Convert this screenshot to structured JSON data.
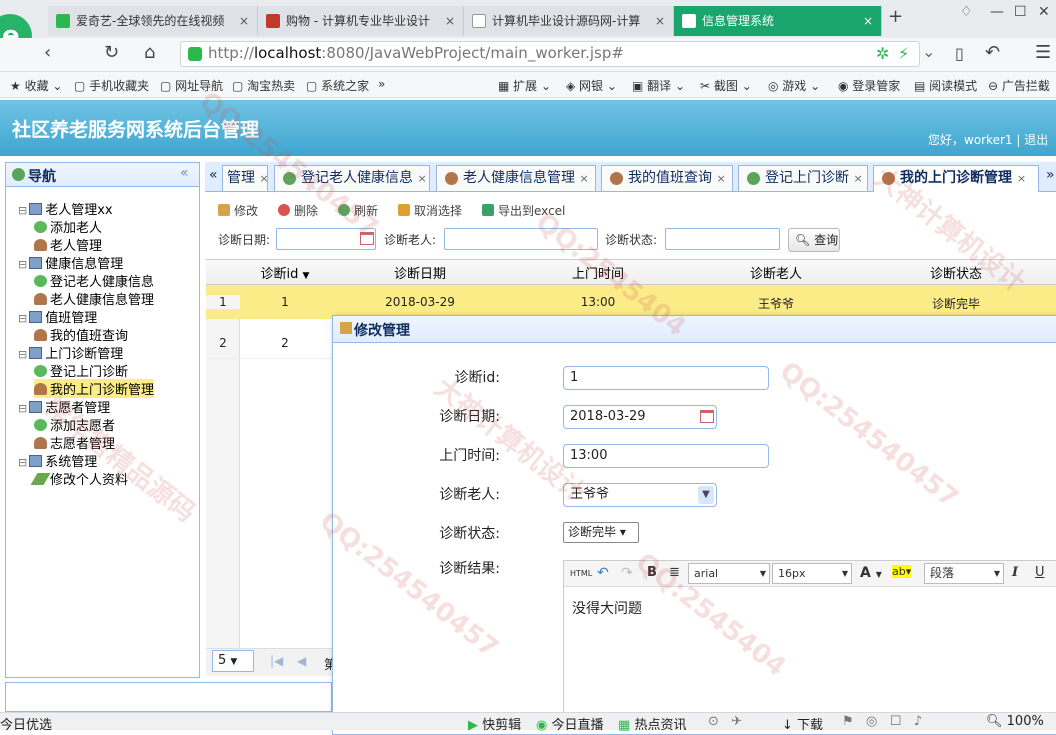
{
  "browser": {
    "tabs": [
      {
        "label": "爱奇艺-全球领先的在线视频"
      },
      {
        "label": "购物 - 计算机专业毕业设计"
      },
      {
        "label": "计算机毕业设计源码网-计算"
      },
      {
        "label": "信息管理系统"
      }
    ],
    "new_tab": "+",
    "url_prefix": "http://",
    "url_host": "localhost",
    "url_rest": ":8080/JavaWebProject/main_worker.jsp#",
    "bookmarks": [
      "收藏",
      "手机收藏夹",
      "网址导航",
      "淘宝热卖",
      "系统之家",
      "»",
      "扩展",
      "网银",
      "翻译",
      "截图",
      "游戏",
      "登录管家",
      "阅读模式",
      "广告拦截"
    ]
  },
  "app": {
    "title": "社区养老服务网系统后台管理",
    "greeting": "您好，worker1",
    "sep": "|",
    "logout": "退出"
  },
  "nav": {
    "title": "导航",
    "collapse": "«",
    "tree": [
      {
        "label": "老人管理xx",
        "type": "folder"
      },
      {
        "label": "添加老人",
        "type": "add"
      },
      {
        "label": "老人管理",
        "type": "user"
      },
      {
        "label": "健康信息管理",
        "type": "folder"
      },
      {
        "label": "登记老人健康信息",
        "type": "add"
      },
      {
        "label": "老人健康信息管理",
        "type": "user"
      },
      {
        "label": "值班管理",
        "type": "folder"
      },
      {
        "label": "我的值班查询",
        "type": "user"
      },
      {
        "label": "上门诊断管理",
        "type": "folder"
      },
      {
        "label": "登记上门诊断",
        "type": "add"
      },
      {
        "label": "我的上门诊断管理",
        "type": "user",
        "selected": true
      },
      {
        "label": "志愿者管理",
        "type": "folder"
      },
      {
        "label": "添加志愿者",
        "type": "add"
      },
      {
        "label": "志愿者管理",
        "type": "user"
      },
      {
        "label": "系统管理",
        "type": "folder"
      },
      {
        "label": "修改个人资料",
        "type": "pen"
      }
    ]
  },
  "tabs": {
    "scroll_left": "«",
    "scroll_right": "»",
    "items": [
      {
        "label": "管理"
      },
      {
        "label": "登记老人健康信息"
      },
      {
        "label": "老人健康信息管理"
      },
      {
        "label": "我的值班查询"
      },
      {
        "label": "登记上门诊断"
      },
      {
        "label": "我的上门诊断管理",
        "active": true
      }
    ],
    "close": "×"
  },
  "toolbar": {
    "edit": "修改",
    "delete": "删除",
    "refresh": "刷新",
    "cancel_select": "取消选择",
    "export": "导出到excel"
  },
  "filters": {
    "date_label": "诊断日期:",
    "elder_label": "诊断老人:",
    "state_label": "诊断状态:",
    "query": "查询"
  },
  "grid": {
    "columns": [
      "诊断id",
      "诊断日期",
      "上门时间",
      "诊断老人",
      "诊断状态"
    ],
    "rows": [
      {
        "num": "1",
        "id": "1",
        "date": "2018-03-29",
        "time": "13:00",
        "elder": "王爷爷",
        "state": "诊断完毕"
      },
      {
        "num": "2",
        "id": "2",
        "date": "",
        "time": "",
        "elder": "",
        "state": ""
      }
    ]
  },
  "pager": {
    "page_size": "5",
    "page_label": "第"
  },
  "dialog": {
    "title": "修改管理",
    "fields": {
      "id_label": "诊断id:",
      "id_value": "1",
      "date_label": "诊断日期:",
      "date_value": "2018-03-29",
      "time_label": "上门时间:",
      "time_value": "13:00",
      "elder_label": "诊断老人:",
      "elder_value": "王爷爷",
      "state_label": "诊断状态:",
      "state_value": "诊断完毕 ▾",
      "result_label": "诊断结果:"
    },
    "editor": {
      "html": "HTML",
      "bold": "B",
      "font": "arial",
      "size": "16px",
      "fontcolor": "A",
      "para": "段落",
      "italic": "I",
      "underline": "U",
      "content": "没得大问题"
    }
  },
  "watermarks": [
    "QQ:2545404",
    "大神计算机设计",
    "常年售精品源码",
    "QQ:254540457"
  ],
  "statusbar": {
    "left": "今日优选",
    "items": [
      "快剪辑",
      "今日直播",
      "热点资讯",
      "下载",
      "100%"
    ]
  }
}
